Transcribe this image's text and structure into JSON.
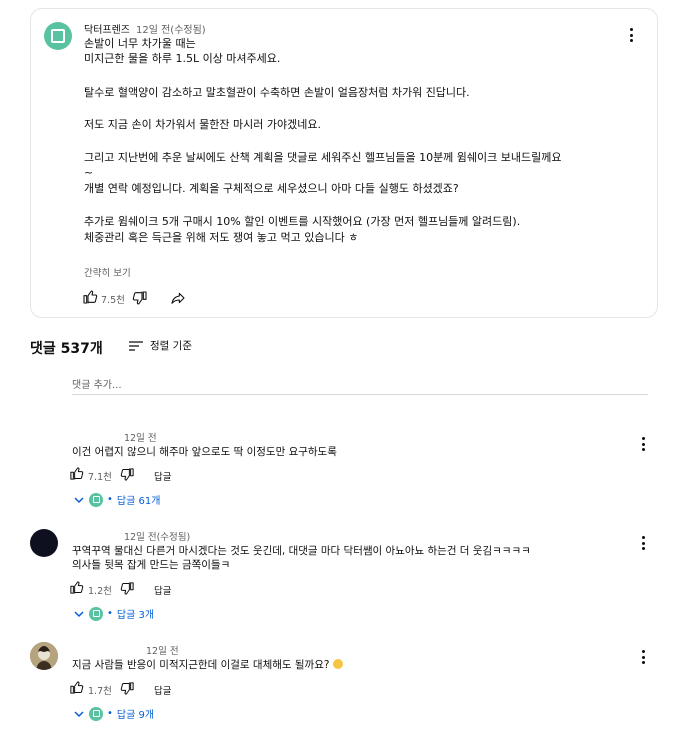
{
  "pinned": {
    "author": "닥터프렌즈",
    "time": "12일 전(수정됨)",
    "lines": [
      "손발이 너무 차가울 때는",
      "미지근한 물을 하루 1.5L 이상 마셔주세요.",
      "탈수로 혈액양이 감소하고 말초혈관이 수축하면 손발이 얼음장처럼 차가워 진답니다.",
      "저도 지금 손이 차가워서 물한잔 마시러 가야겠네요.",
      "그리고 지난번에 추운 날씨에도 산책 계획을 댓글로 세워주신 헬프님들을 10분께 윔쉐이크 보내드릴께요",
      "~",
      "개별 연락 예정입니다. 계획을 구체적으로 세우셨으니 아마 다들 실행도 하셨겠죠?",
      "추가로 윔쉐이크 5개 구매시 10% 할인 이벤트를 시작했어요 (가장 먼저 헬프님들께 알려드림).",
      "체중관리 혹은 득근을 위해 저도 쟁여 놓고 먹고 있습니다 ㅎ"
    ],
    "show_less": "간략히 보기",
    "likes": "7.5천"
  },
  "comments_header": {
    "count_label": "댓글 537개",
    "sort_label": "정렬 기준"
  },
  "add_comment": {
    "placeholder": "댓글 추가..."
  },
  "comments": [
    {
      "time": "12일 전",
      "text": "이건 어렵지 않으니 해주마 앞으로도 딱 이정도만 요구하도록",
      "likes": "7.1천",
      "reply_label": "답글",
      "replies": "답글 61개"
    },
    {
      "time": "12일 전(수정됨)",
      "text": "꾸역꾸역 물대신 다른거 마시겠다는 것도 웃긴데, 대댓글 마다 닥터쌤이 아뇨아뇨 하는건 더 웃김ㅋㅋㅋㅋ",
      "text2": "의사들 뒷목 잡게 만드는 금쪽이들ㅋ",
      "likes": "1.2천",
      "reply_label": "답글",
      "replies": "답글 3개"
    },
    {
      "time": "12일 전",
      "text": "지금 사람들 반응이 미적지근한데 이걸로 대체해도 될까요?",
      "likes": "1.7천",
      "reply_label": "답글",
      "replies": "답글 9개"
    }
  ],
  "separator": "•",
  "colors": {
    "accent": "#065fd4",
    "channel_avatar": "#59c2a0",
    "text": "#0f0f0f",
    "secondary": "#606060"
  }
}
